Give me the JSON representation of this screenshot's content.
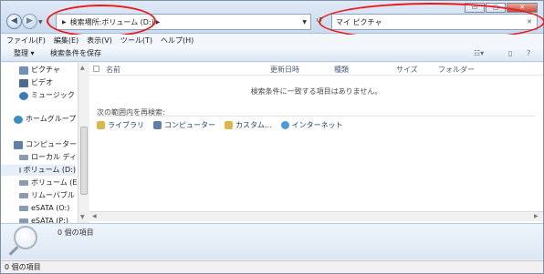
{
  "window": {
    "controls": {
      "minimize": "▭",
      "maximize": "▢",
      "close": "✕"
    }
  },
  "nav": {
    "back": "◀",
    "forward": "▶",
    "dropdown": "▼"
  },
  "address": {
    "crumb_prefix": "検索場所:",
    "crumb_location": "ボリューム (D:)",
    "refresh": "↺"
  },
  "search": {
    "query": "マイ ピクチャ",
    "clear": "✕"
  },
  "menubar": [
    "ファイル(F)",
    "編集(E)",
    "表示(V)",
    "ツール(T)",
    "ヘルプ(H)"
  ],
  "toolbar": {
    "organize": "整理 ▾",
    "save_search": "検索条件を保存"
  },
  "sidebar": {
    "items": [
      {
        "label": "ピクチャ",
        "icon_color": "#6f8fbd"
      },
      {
        "label": "ビデオ",
        "icon_color": "#4d6b8f"
      },
      {
        "label": "ミュージック",
        "icon_color": "#3a7ab8"
      },
      {
        "label": "ホームグループ",
        "icon_color": "#3a8fc0"
      },
      {
        "label": "コンピューター",
        "icon_color": "#5d7fa8"
      },
      {
        "label": "ローカル ディス",
        "icon_color": "#8b9aae"
      },
      {
        "label": "ボリューム (D:)",
        "icon_color": "#8b9aae"
      },
      {
        "label": "ボリューム (E:)",
        "icon_color": "#8b9aae"
      },
      {
        "label": "リムーバブル デ",
        "icon_color": "#8b9aae"
      },
      {
        "label": "eSATA (O:)",
        "icon_color": "#8b9aae"
      },
      {
        "label": "eSATA (P:)",
        "icon_color": "#8b9aae"
      }
    ]
  },
  "columns": [
    "名前",
    "更新日時",
    "種類",
    "サイズ",
    "フォルダー"
  ],
  "content": {
    "empty_message": "検索条件に一致する項目はありません。",
    "search_again_label": "次の範囲内を再検索:",
    "scopes": [
      {
        "label": "ライブラリ",
        "icon_color": "#d9b84a"
      },
      {
        "label": "コンピューター",
        "icon_color": "#5d7fa8"
      },
      {
        "label": "カスタム...",
        "icon_color": "#d9b84a"
      },
      {
        "label": "インターネット",
        "icon_color": "#4c9ad9"
      }
    ]
  },
  "details": {
    "count": "0 個の項目"
  },
  "status": {
    "text": "0 個の項目"
  },
  "annotation_color": "#ee1a1a"
}
